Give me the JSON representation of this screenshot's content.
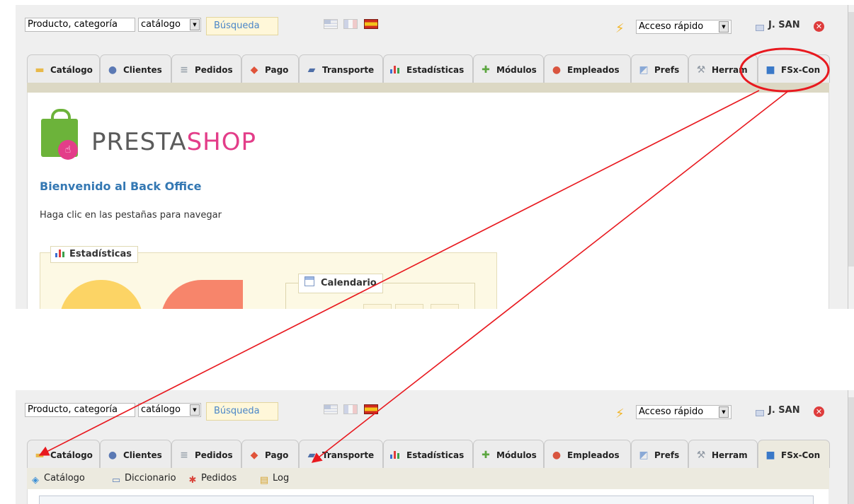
{
  "header": {
    "search_value": "Producto, categoría",
    "scope_value": "catálogo",
    "search_button": "Búsqueda",
    "quick_access": "Acceso rápido",
    "user_name": "J. SAN"
  },
  "tabs": [
    {
      "label": "Catálogo",
      "icon": "folder-icon"
    },
    {
      "label": "Clientes",
      "icon": "user-icon"
    },
    {
      "label": "Pedidos",
      "icon": "document-icon"
    },
    {
      "label": "Pago",
      "icon": "payment-icon"
    },
    {
      "label": "Transporte",
      "icon": "truck-icon"
    },
    {
      "label": "Estadísticas",
      "icon": "bar-chart-icon"
    },
    {
      "label": "Módulos",
      "icon": "puzzle-icon"
    },
    {
      "label": "Empleados",
      "icon": "employee-icon"
    },
    {
      "label": "Prefs",
      "icon": "preferences-icon"
    },
    {
      "label": "Herram",
      "icon": "wrench-icon"
    },
    {
      "label": "FSx-Con",
      "icon": "cube-icon"
    }
  ],
  "home": {
    "logo_text_1": "PRESTA",
    "logo_text_2": "SHOP",
    "welcome": "Bienvenido al Back Office",
    "hint": "Haga clic en las pestañas para navegar",
    "stats_title": "Estadísticas",
    "calendar_title": "Calendario"
  },
  "submenu": [
    {
      "label": "Catálogo",
      "icon": "catalog-icon"
    },
    {
      "label": "Diccionario",
      "icon": "book-icon"
    },
    {
      "label": "Pedidos",
      "icon": "orders-icon"
    },
    {
      "label": "Log",
      "icon": "log-icon"
    }
  ],
  "colors": {
    "annotation_red": "#e8191f",
    "link_blue": "#3478b3",
    "prestashop_pink": "#e33d89",
    "prestashop_green": "#6cb33a"
  }
}
